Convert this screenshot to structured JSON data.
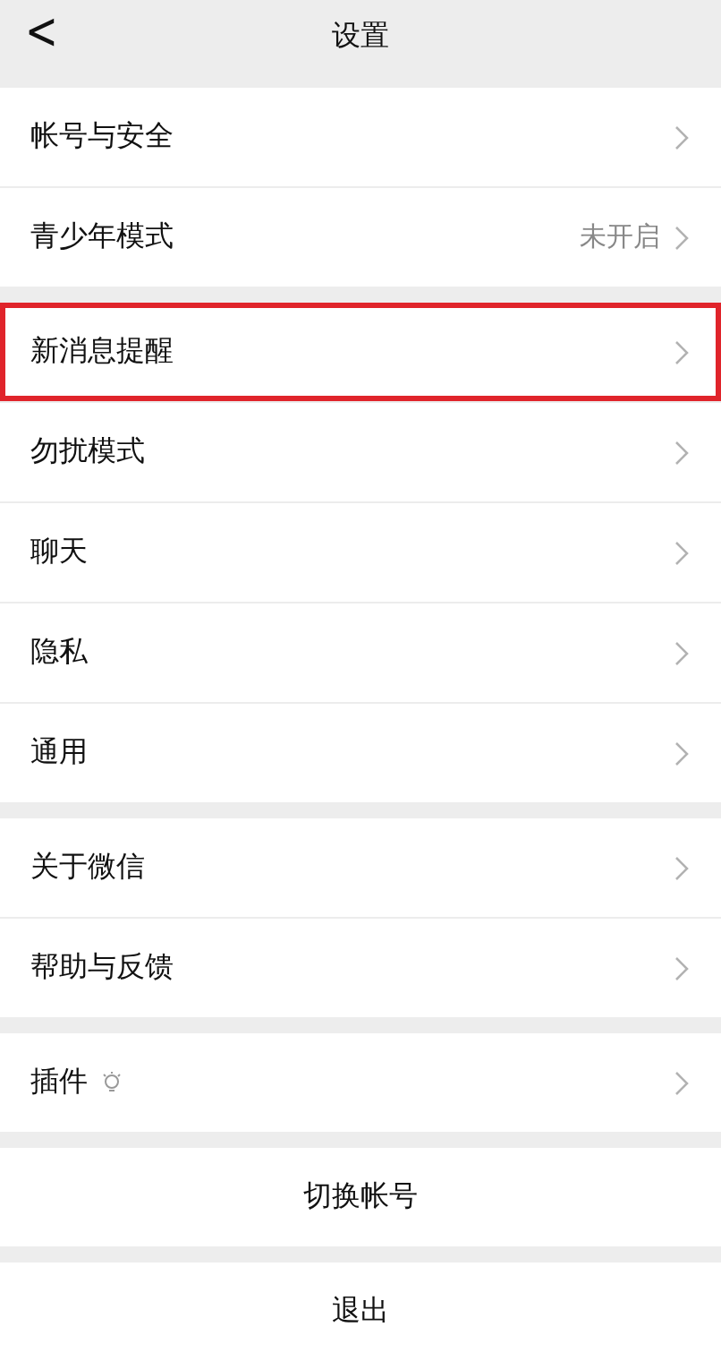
{
  "header": {
    "back": "<",
    "title": "设置"
  },
  "sections": [
    {
      "items": [
        {
          "kind": "nav",
          "label": "帐号与安全",
          "highlighted": false
        },
        {
          "kind": "nav",
          "label": "青少年模式",
          "value": "未开启",
          "highlighted": false
        }
      ]
    },
    {
      "items": [
        {
          "kind": "nav",
          "label": "新消息提醒",
          "highlighted": true
        },
        {
          "kind": "nav",
          "label": "勿扰模式",
          "highlighted": false
        },
        {
          "kind": "nav",
          "label": "聊天",
          "highlighted": false
        },
        {
          "kind": "nav",
          "label": "隐私",
          "highlighted": false
        },
        {
          "kind": "nav",
          "label": "通用",
          "highlighted": false
        }
      ]
    },
    {
      "items": [
        {
          "kind": "nav",
          "label": "关于微信",
          "highlighted": false
        },
        {
          "kind": "nav",
          "label": "帮助与反馈",
          "highlighted": false
        }
      ]
    },
    {
      "items": [
        {
          "kind": "plugin",
          "label": "插件",
          "highlighted": false
        }
      ]
    },
    {
      "items": [
        {
          "kind": "action",
          "label": "切换帐号",
          "highlighted": false
        }
      ]
    },
    {
      "items": [
        {
          "kind": "action",
          "label": "退出",
          "highlighted": false
        }
      ]
    }
  ]
}
